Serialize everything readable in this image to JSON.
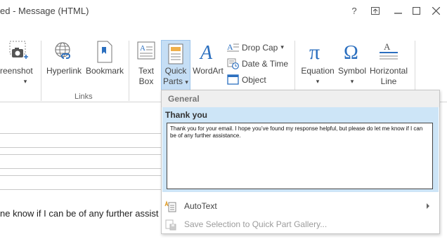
{
  "window": {
    "title": "ed - Message (HTML)",
    "help_label": "?",
    "restore_label": "⧉",
    "minimize_label": "—",
    "maximize_label": "☐"
  },
  "ribbon": {
    "screenshot_label": "reenshot",
    "hyperlink_label": "Hyperlink",
    "bookmark_label": "Bookmark",
    "textbox_line1": "Text",
    "textbox_line2": "Box",
    "quickparts_line1": "Quick",
    "quickparts_line2": "Parts",
    "wordart_label": "WordArt",
    "dropcap_label": "Drop Cap",
    "datetime_label": "Date & Time",
    "object_label": "Object",
    "equation_label": "Equation",
    "symbol_label": "Symbol",
    "hline_line1": "Horizontal",
    "hline_line2": "Line",
    "links_group_label": "Links",
    "dropdown_caret": "▾"
  },
  "compose": {
    "body_text": "ne know if I can be of any further assist"
  },
  "quick_parts_menu": {
    "category": "General",
    "part_name": "Thank you",
    "part_preview": "Thank you for your email. I hope you’ve found my response helpful, but please do let me know if I can be of any further assistance.",
    "autotext_label": "AutoText",
    "save_selection_label": "Save Selection to Quick Part Gallery..."
  },
  "colors": {
    "accent_blue": "#2b6fbf",
    "selected_bg": "#cde5f7",
    "quickparts_active_bg": "#c5def5"
  }
}
